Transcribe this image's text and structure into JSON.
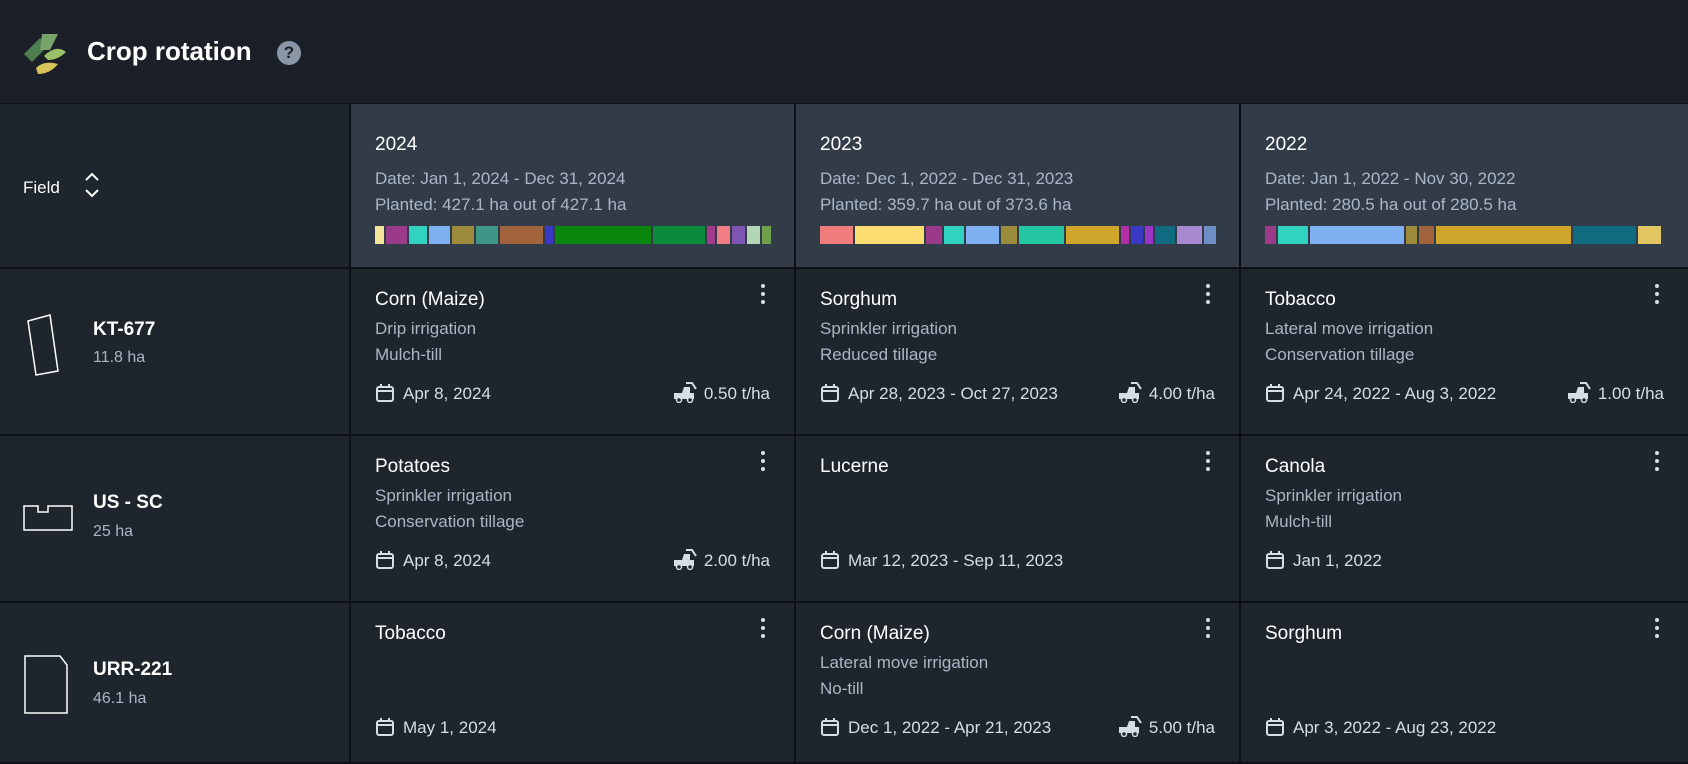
{
  "header": {
    "title": "Crop rotation",
    "help_icon": "question-circle-icon",
    "logo_icon": "leaf-logo-icon"
  },
  "table": {
    "field_header": "Field",
    "years": [
      {
        "year": "2024",
        "date": "Date: Jan 1, 2024 - Dec 31, 2024",
        "planted": "Planted: 427.1 ha out of 427.1 ha",
        "bar": [
          {
            "color": "#f3e69a",
            "weight": 2
          },
          {
            "color": "#9b3a88",
            "weight": 5
          },
          {
            "color": "#32d2c0",
            "weight": 4
          },
          {
            "color": "#7fb0f2",
            "weight": 5
          },
          {
            "color": "#9d8b3c",
            "weight": 5
          },
          {
            "color": "#3d9686",
            "weight": 5
          },
          {
            "color": "#a0633c",
            "weight": 10
          },
          {
            "color": "#3a38c4",
            "weight": 2
          },
          {
            "color": "#0a860e",
            "weight": 22
          },
          {
            "color": "#0b8a3c",
            "weight": 12
          },
          {
            "color": "#a23b8c",
            "weight": 2
          },
          {
            "color": "#f07d86",
            "weight": 3
          },
          {
            "color": "#7e56b2",
            "weight": 3
          },
          {
            "color": "#b3d6b7",
            "weight": 3
          },
          {
            "color": "#6ea04b",
            "weight": 2
          }
        ]
      },
      {
        "year": "2023",
        "date": "Date: Dec 1, 2022 - Dec 31, 2023",
        "planted": "Planted: 359.7 ha out of 373.6 ha",
        "bar": [
          {
            "color": "#f17c7d",
            "weight": 8
          },
          {
            "color": "#fcdd72",
            "weight": 17
          },
          {
            "color": "#9b3a88",
            "weight": 4
          },
          {
            "color": "#32d2c0",
            "weight": 5
          },
          {
            "color": "#7fb0f2",
            "weight": 8
          },
          {
            "color": "#9d8b3c",
            "weight": 4
          },
          {
            "color": "#23c6a0",
            "weight": 11
          },
          {
            "color": "#cfa52b",
            "weight": 13
          },
          {
            "color": "#b22fa6",
            "weight": 2
          },
          {
            "color": "#3a38c4",
            "weight": 3
          },
          {
            "color": "#9a35c8",
            "weight": 2
          },
          {
            "color": "#0e6b80",
            "weight": 5
          },
          {
            "color": "#a88ad2",
            "weight": 6
          },
          {
            "color": "#6d8fc6",
            "weight": 3
          }
        ]
      },
      {
        "year": "2022",
        "date": "Date: Jan 1, 2022 - Nov 30, 2022",
        "planted": "Planted: 280.5 ha out of 280.5 ha",
        "bar": [
          {
            "color": "#9b3a88",
            "weight": 3
          },
          {
            "color": "#32d2c0",
            "weight": 8
          },
          {
            "color": "#7fb0f2",
            "weight": 25
          },
          {
            "color": "#9d8b3c",
            "weight": 3
          },
          {
            "color": "#a0633c",
            "weight": 4
          },
          {
            "color": "#cfa52b",
            "weight": 36
          },
          {
            "color": "#0e6b80",
            "weight": 17
          },
          {
            "color": "#e2c662",
            "weight": 6
          }
        ]
      }
    ],
    "fields": [
      {
        "name": "KT-677",
        "area": "11.8 ha",
        "shape": "field-shape-icon",
        "crops": [
          {
            "crop": "Corn (Maize)",
            "line1": "Drip irrigation",
            "line2": "Mulch-till",
            "dates": "Apr 8, 2024",
            "yield": "0.50 t/ha"
          },
          {
            "crop": "Sorghum",
            "line1": "Sprinkler irrigation",
            "line2": "Reduced tillage",
            "dates": "Apr 28, 2023 - Oct 27, 2023",
            "yield": "4.00 t/ha"
          },
          {
            "crop": "Tobacco",
            "line1": "Lateral move irrigation",
            "line2": "Conservation tillage",
            "dates": "Apr 24, 2022 - Aug 3, 2022",
            "yield": "1.00 t/ha"
          }
        ]
      },
      {
        "name": "US - SC",
        "area": "25 ha",
        "shape": "field-shape-icon",
        "crops": [
          {
            "crop": "Potatoes",
            "line1": "Sprinkler irrigation",
            "line2": "Conservation tillage",
            "dates": "Apr 8, 2024",
            "yield": "2.00 t/ha"
          },
          {
            "crop": "Lucerne",
            "line1": "",
            "line2": "",
            "dates": "Mar 12, 2023 - Sep 11, 2023",
            "yield": ""
          },
          {
            "crop": "Canola",
            "line1": "Sprinkler irrigation",
            "line2": "Mulch-till",
            "dates": "Jan 1, 2022",
            "yield": ""
          }
        ]
      },
      {
        "name": "URR-221",
        "area": "46.1 ha",
        "shape": "field-shape-icon",
        "crops": [
          {
            "crop": "Tobacco",
            "line1": "",
            "line2": "",
            "dates": "May 1, 2024",
            "yield": ""
          },
          {
            "crop": "Corn (Maize)",
            "line1": "Lateral move irrigation",
            "line2": "No-till",
            "dates": "Dec 1, 2022 - Apr 21, 2023",
            "yield": "5.00 t/ha"
          },
          {
            "crop": "Sorghum",
            "line1": "",
            "line2": "",
            "dates": "Apr 3, 2022 - Aug 23, 2022",
            "yield": ""
          }
        ]
      }
    ]
  }
}
